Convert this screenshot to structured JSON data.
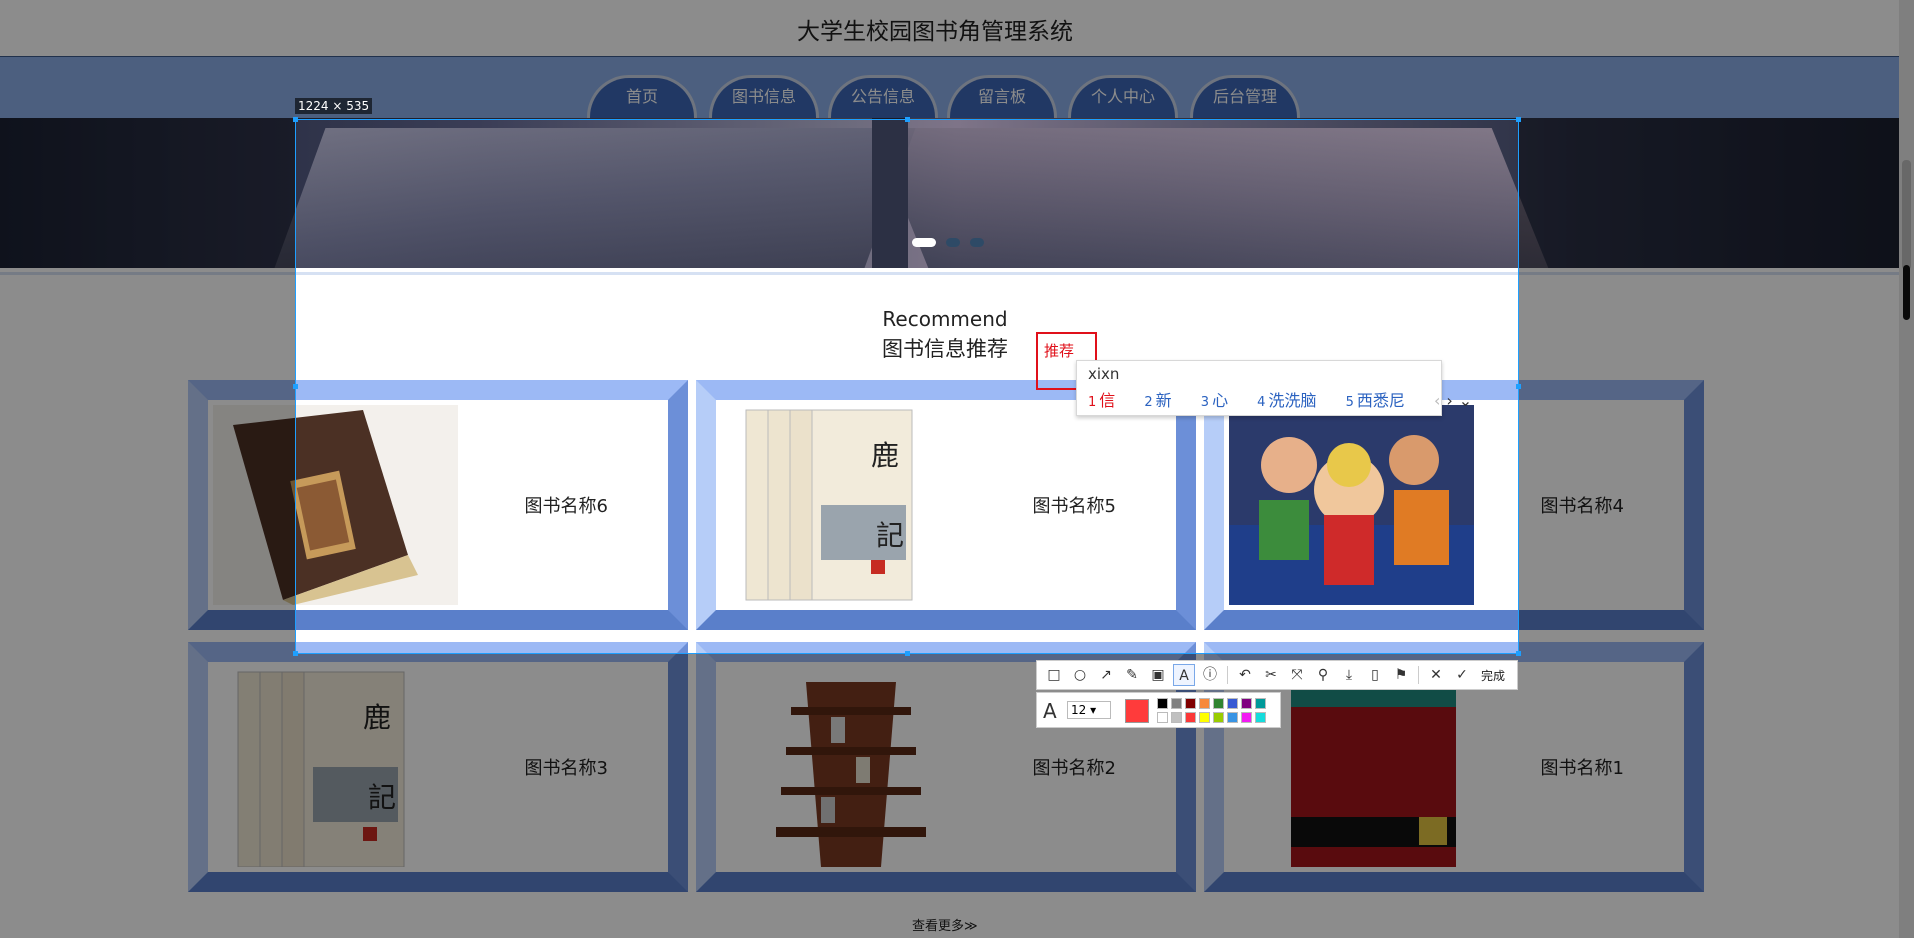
{
  "site": {
    "title": "大学生校园图书角管理系统"
  },
  "nav": [
    {
      "label": "首页"
    },
    {
      "label": "图书信息"
    },
    {
      "label": "公告信息"
    },
    {
      "label": "留言板"
    },
    {
      "label": "个人中心"
    },
    {
      "label": "后台管理"
    }
  ],
  "banner": {
    "dots": 3,
    "active_dot": 1
  },
  "section": {
    "title_en": "Recommend",
    "title_cn": "图书信息推荐"
  },
  "books": [
    {
      "name": "图书名称6",
      "cover": "leather-book-image"
    },
    {
      "name": "图书名称5",
      "cover": "鹿鼎記-box-set-image"
    },
    {
      "name": "图书名称4",
      "cover": "one-piece-image"
    },
    {
      "name": "图书名称3",
      "cover": "鹿鼎記-box-set-image"
    },
    {
      "name": "图书名称2",
      "cover": "bookshelf-tower-image"
    },
    {
      "name": "图书名称1",
      "cover": "13级台阶-book-image"
    }
  ],
  "more_link": "查看更多≫",
  "screenshot_tool": {
    "size_label": "1224 × 535",
    "annotation_text": "推荐",
    "ime": {
      "code": "xixn",
      "candidates": [
        {
          "num": "1",
          "text": "信"
        },
        {
          "num": "2",
          "text": "新"
        },
        {
          "num": "3",
          "text": "心"
        },
        {
          "num": "4",
          "text": "洗洗脑"
        },
        {
          "num": "5",
          "text": "西悉尼"
        }
      ]
    },
    "done_label": "完成",
    "font_size": "12",
    "current_color": "#ff3b3b",
    "palette": [
      "#000000",
      "#808080",
      "#800000",
      "#f7883a",
      "#308430",
      "#385ad3",
      "#800080",
      "#009999",
      "#ffffff",
      "#c0c0c0",
      "#fb3838",
      "#ffff00",
      "#99cc00",
      "#3894e4",
      "#f31bf3",
      "#16dcdc"
    ]
  },
  "colors": {
    "nav_tab": "#3d67b6",
    "nav_bar": "#8aaee8",
    "card_frame": "#9cb9f5",
    "selection": "#1e9fff"
  }
}
